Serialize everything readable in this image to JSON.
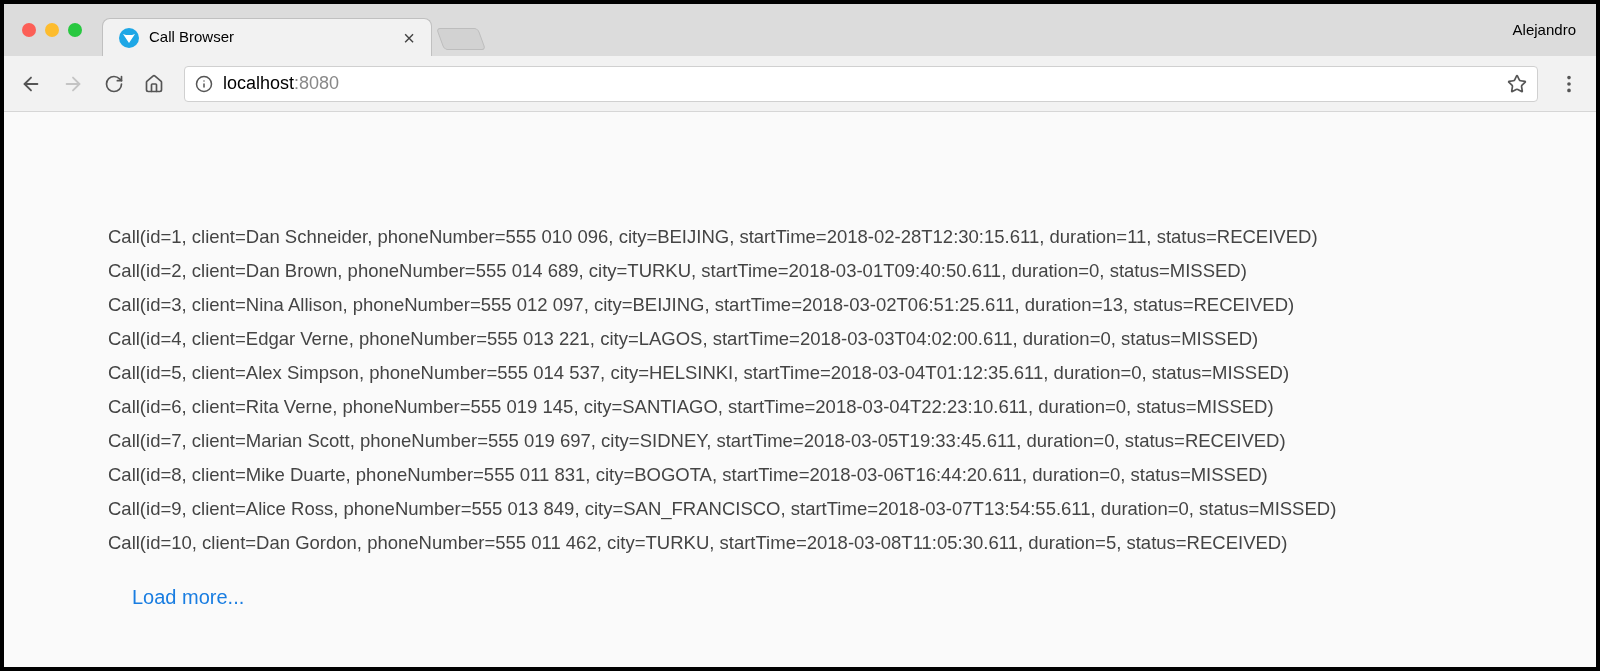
{
  "browser": {
    "tab": {
      "title": "Call Browser",
      "close": "×"
    },
    "profile": "Alejandro",
    "address": {
      "host": "localhost",
      "port": ":8080"
    }
  },
  "calls": [
    "Call(id=1, client=Dan Schneider, phoneNumber=555 010 096, city=BEIJING, startTime=2018-02-28T12:30:15.611, duration=11, status=RECEIVED)",
    "Call(id=2, client=Dan Brown, phoneNumber=555 014 689, city=TURKU, startTime=2018-03-01T09:40:50.611, duration=0, status=MISSED)",
    "Call(id=3, client=Nina Allison, phoneNumber=555 012 097, city=BEIJING, startTime=2018-03-02T06:51:25.611, duration=13, status=RECEIVED)",
    "Call(id=4, client=Edgar Verne, phoneNumber=555 013 221, city=LAGOS, startTime=2018-03-03T04:02:00.611, duration=0, status=MISSED)",
    "Call(id=5, client=Alex Simpson, phoneNumber=555 014 537, city=HELSINKI, startTime=2018-03-04T01:12:35.611, duration=0, status=MISSED)",
    "Call(id=6, client=Rita Verne, phoneNumber=555 019 145, city=SANTIAGO, startTime=2018-03-04T22:23:10.611, duration=0, status=MISSED)",
    "Call(id=7, client=Marian Scott, phoneNumber=555 019 697, city=SIDNEY, startTime=2018-03-05T19:33:45.611, duration=0, status=RECEIVED)",
    "Call(id=8, client=Mike Duarte, phoneNumber=555 011 831, city=BOGOTA, startTime=2018-03-06T16:44:20.611, duration=0, status=MISSED)",
    "Call(id=9, client=Alice Ross, phoneNumber=555 013 849, city=SAN_FRANCISCO, startTime=2018-03-07T13:54:55.611, duration=0, status=MISSED)",
    "Call(id=10, client=Dan Gordon, phoneNumber=555 011 462, city=TURKU, startTime=2018-03-08T11:05:30.611, duration=5, status=RECEIVED)"
  ],
  "load_more": "Load more..."
}
